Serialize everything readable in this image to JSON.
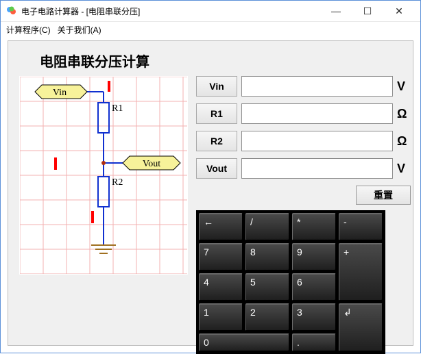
{
  "window": {
    "title": "电子电路计算器 - [电阻串联分压]",
    "minimize": "—",
    "maximize": "☐",
    "close": "✕"
  },
  "menu": {
    "calc": "计算程序(C)",
    "about": "关于我们(A)"
  },
  "heading": "电阻串联分压计算",
  "diagram": {
    "vin": "Vin",
    "r1": "R1",
    "r2": "R2",
    "vout": "Vout"
  },
  "fields": {
    "vin": {
      "label": "Vin",
      "value": "",
      "unit": "V"
    },
    "r1": {
      "label": "R1",
      "value": "",
      "unit": "Ω"
    },
    "r2": {
      "label": "R2",
      "value": "",
      "unit": "Ω"
    },
    "vout": {
      "label": "Vout",
      "value": "",
      "unit": "V"
    }
  },
  "reset": "重置",
  "keypad": {
    "back": "←",
    "div": "/",
    "mul": "*",
    "sub": "-",
    "k7": "7",
    "k8": "8",
    "k9": "9",
    "add": "+",
    "k4": "4",
    "k5": "5",
    "k6": "6",
    "k1": "1",
    "k2": "2",
    "k3": "3",
    "enter": "↲",
    "k0": "0",
    "dot": "."
  }
}
